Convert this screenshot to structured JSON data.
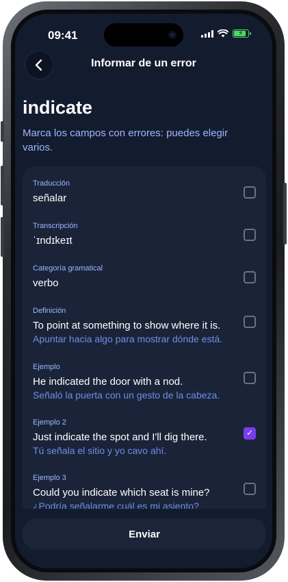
{
  "status": {
    "time": "09:41"
  },
  "header": {
    "title": "Informar de un error"
  },
  "word": "indicate",
  "instructions": "Marca los campos con errores: puedes elegir varios.",
  "fields": [
    {
      "label": "Traducción",
      "value": "señalar",
      "translation": "",
      "checked": false
    },
    {
      "label": "Transcripción",
      "value": "ˈɪndɪkeɪt",
      "translation": "",
      "checked": false
    },
    {
      "label": "Categoría gramatical",
      "value": "verbo",
      "translation": "",
      "checked": false
    },
    {
      "label": "Definición",
      "value": "To point at something to show where it is.",
      "translation": "Apuntar hacia algo para mostrar dónde está.",
      "checked": false
    },
    {
      "label": "Ejemplo",
      "value": "He indicated the door with a nod.",
      "translation": "Señaló la puerta con un gesto de la cabeza.",
      "checked": false
    },
    {
      "label": "Ejemplo 2",
      "value": "Just indicate the spot and I'll dig there.",
      "translation": "Tú señala el sitio y yo cavo ahí.",
      "checked": true
    },
    {
      "label": "Ejemplo 3",
      "value": "Could you indicate which seat is mine?",
      "translation": "¿Podría señalarme cuál es mi asiento?",
      "checked": false
    }
  ],
  "send_label": "Enviar",
  "colors": {
    "accent": "#7a3cf0",
    "background": "#131b2e",
    "card": "#1a2338",
    "link": "#9db8ff"
  }
}
